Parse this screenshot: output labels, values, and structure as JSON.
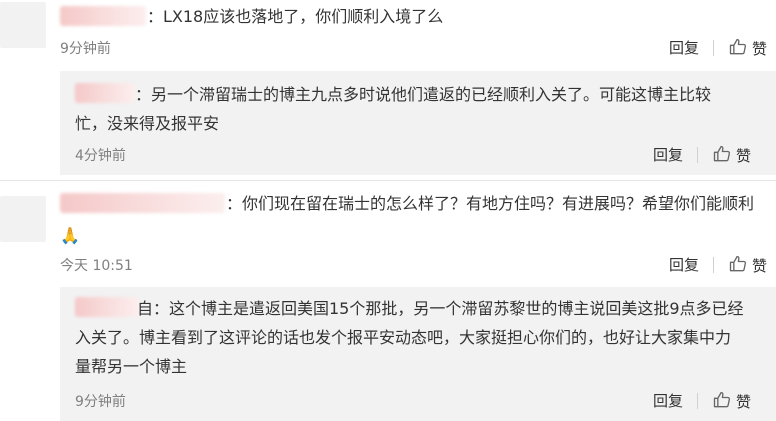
{
  "comments": [
    {
      "text": "：LX18应该也落地了，你们顺利入境了么",
      "time": "9分钟前",
      "reply_label": "回复",
      "like_label": "赞"
    },
    {
      "text_line1": "：另一个滞留瑞士的博主九点多时说他们遣返的已经顺利入关了。可能这博主比较",
      "text_line2": "忙，没来得及报平安",
      "time": "4分钟前",
      "reply_label": "回复",
      "like_label": "赞"
    },
    {
      "text_line1": "：你们现在留在瑞士的怎么样了？有地方住吗？有进展吗？希望你们能顺利",
      "emoji": "🙏",
      "time": "今天 10:51",
      "reply_label": "回复",
      "like_label": "赞"
    },
    {
      "text_line1": "自：这个博主是遣返回美国15个那批，另一个滞留苏黎世的博主说回美这批9点多已经",
      "text_line2": "入关了。博主看到了这评论的话也发个报平安动态吧，大家挺担心你们的，也好让大家集中力",
      "text_line3": "量帮另一个博主",
      "time": "9分钟前",
      "reply_label": "回复",
      "like_label": "赞"
    }
  ],
  "icons": {
    "like": "thumbs-up-icon"
  },
  "colors": {
    "reply_bg": "#f2f2f2",
    "text": "#333333",
    "muted": "#808080"
  }
}
